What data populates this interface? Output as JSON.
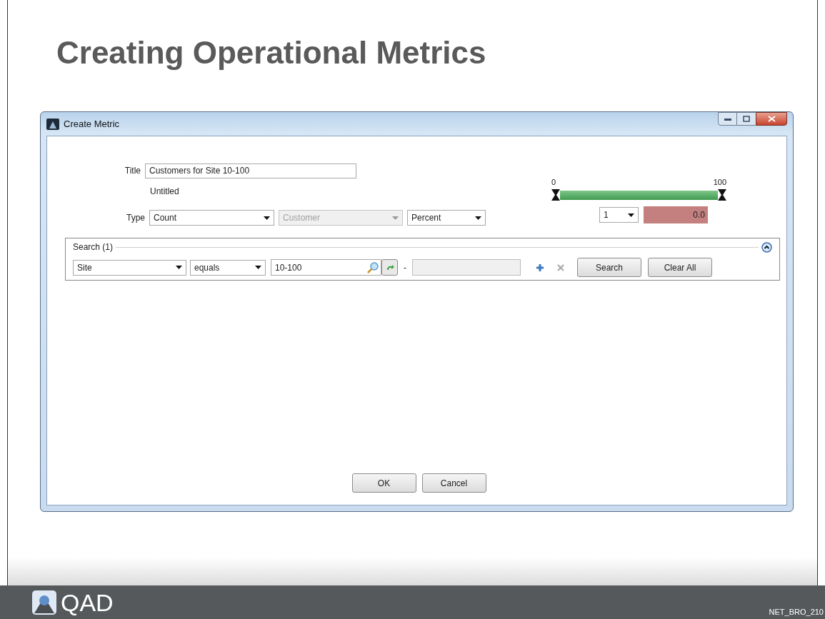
{
  "slide": {
    "title": "Creating Operational Metrics",
    "logo_text": "QAD",
    "footer_code": "NET_BRO_210"
  },
  "window": {
    "title": "Create Metric"
  },
  "form": {
    "title_label": "Title",
    "title_value": "Customers for Site 10-100",
    "subtitle": "Untitled",
    "type_label": "Type",
    "dropdowns": [
      {
        "value": "Count",
        "disabled": false
      },
      {
        "value": "Customer",
        "disabled": true
      },
      {
        "value": "Percent",
        "disabled": false
      }
    ]
  },
  "range": {
    "min_label": "0",
    "max_label": "100",
    "step": "1",
    "result": "0.0"
  },
  "search": {
    "legend": "Search (1)",
    "expanded": true,
    "field": "Site",
    "operator": "equals",
    "value": "10-100",
    "separator": "-",
    "buttons": [
      "Search",
      "Clear All"
    ]
  },
  "buttons": [
    "OK",
    "Cancel"
  ]
}
